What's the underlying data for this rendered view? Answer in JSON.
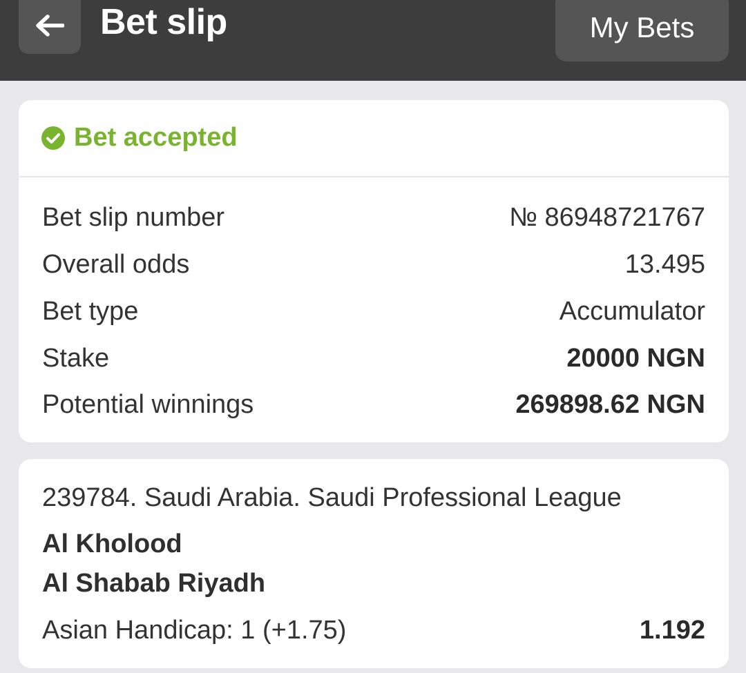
{
  "header": {
    "title": "Bet slip",
    "back_icon": "arrow-left-icon",
    "my_bets_label": "My Bets"
  },
  "summary": {
    "status_icon": "check-circle-icon",
    "status_text": "Bet accepted",
    "status_color": "#7ab32e",
    "rows": [
      {
        "label": "Bet slip number",
        "value": "№ 86948721767"
      },
      {
        "label": "Overall odds",
        "value": "13.495"
      },
      {
        "label": "Bet type",
        "value": "Accumulator"
      },
      {
        "label": "Stake",
        "value": "20000 NGN"
      },
      {
        "label": "Potential winnings",
        "value": "269898.62 NGN"
      }
    ]
  },
  "event": {
    "league": "239784. Saudi Arabia. Saudi Professional League",
    "team1": "Al Kholood",
    "team2": "Al Shabab Riyadh",
    "market": "Asian Handicap: 1 (+1.75)",
    "odds": "1.192"
  }
}
